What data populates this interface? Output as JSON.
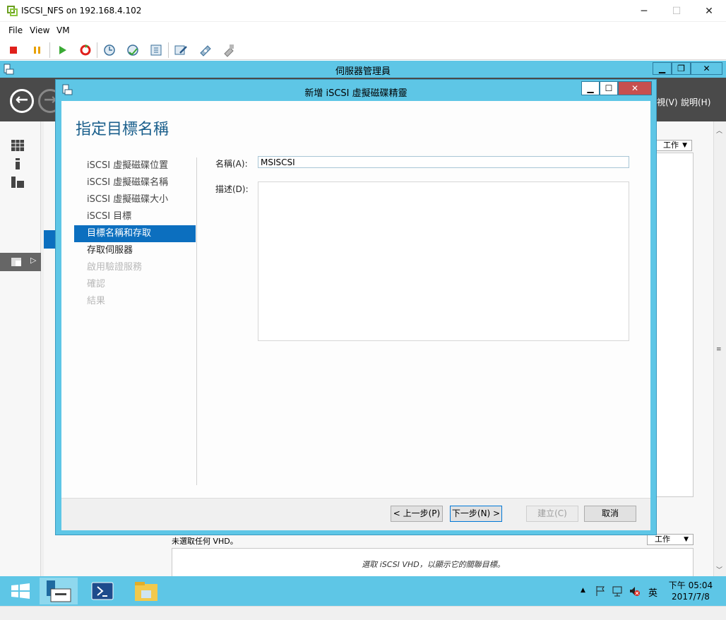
{
  "vm_window": {
    "title": "ISCSI_NFS on 192.168.4.102",
    "controls": {
      "minimize": "─",
      "maximize": "☐",
      "close": "✕"
    },
    "menu": [
      "File",
      "View",
      "VM"
    ],
    "toolbar_icons": [
      "stop-icon",
      "pause-icon",
      "play-icon",
      "reset-icon",
      "snapshot-icon",
      "revert-snapshot-icon",
      "manage-snapshots-icon",
      "edit-settings-icon",
      "cd-dvd-icon",
      "network-icon"
    ]
  },
  "server_manager": {
    "title": "伺服器管理員",
    "controls": {
      "minimize": "▁",
      "restore": "❐",
      "close": "✕"
    },
    "header_menu": {
      "view": "視(V)",
      "help": "說明(H)"
    },
    "task_label": "工作",
    "lower_label": "未選取任何 VHD。",
    "lower_hint": "選取 iSCSI VHD，以顯示它的關聯目標。"
  },
  "wizard": {
    "title": "新增 iSCSI 虛擬磁碟精靈",
    "controls": {
      "minimize": "▁",
      "maximize": "☐",
      "close": "✕"
    },
    "heading": "指定目標名稱",
    "steps": [
      {
        "label": "iSCSI 虛擬磁碟位置",
        "state": "done"
      },
      {
        "label": "iSCSI 虛擬磁碟名稱",
        "state": "done"
      },
      {
        "label": "iSCSI 虛擬磁碟大小",
        "state": "done"
      },
      {
        "label": "iSCSI 目標",
        "state": "done"
      },
      {
        "label": "目標名稱和存取",
        "state": "active"
      },
      {
        "label": "存取伺服器",
        "state": "current"
      },
      {
        "label": "啟用驗證服務",
        "state": "disabled"
      },
      {
        "label": "確認",
        "state": "disabled"
      },
      {
        "label": "結果",
        "state": "disabled"
      }
    ],
    "name_label": "名稱(A):",
    "name_value": "MSISCSI",
    "desc_label": "描述(D):",
    "desc_value": "",
    "buttons": {
      "prev": "< 上一步(P)",
      "next": "下一步(N) >",
      "create": "建立(C)",
      "cancel": "取消"
    }
  },
  "taskbar": {
    "apps": [
      "start-icon",
      "server-manager-icon",
      "powershell-icon",
      "file-explorer-icon"
    ],
    "tray_lang": "英",
    "time": "下午 05:04",
    "date": "2017/7/8"
  }
}
